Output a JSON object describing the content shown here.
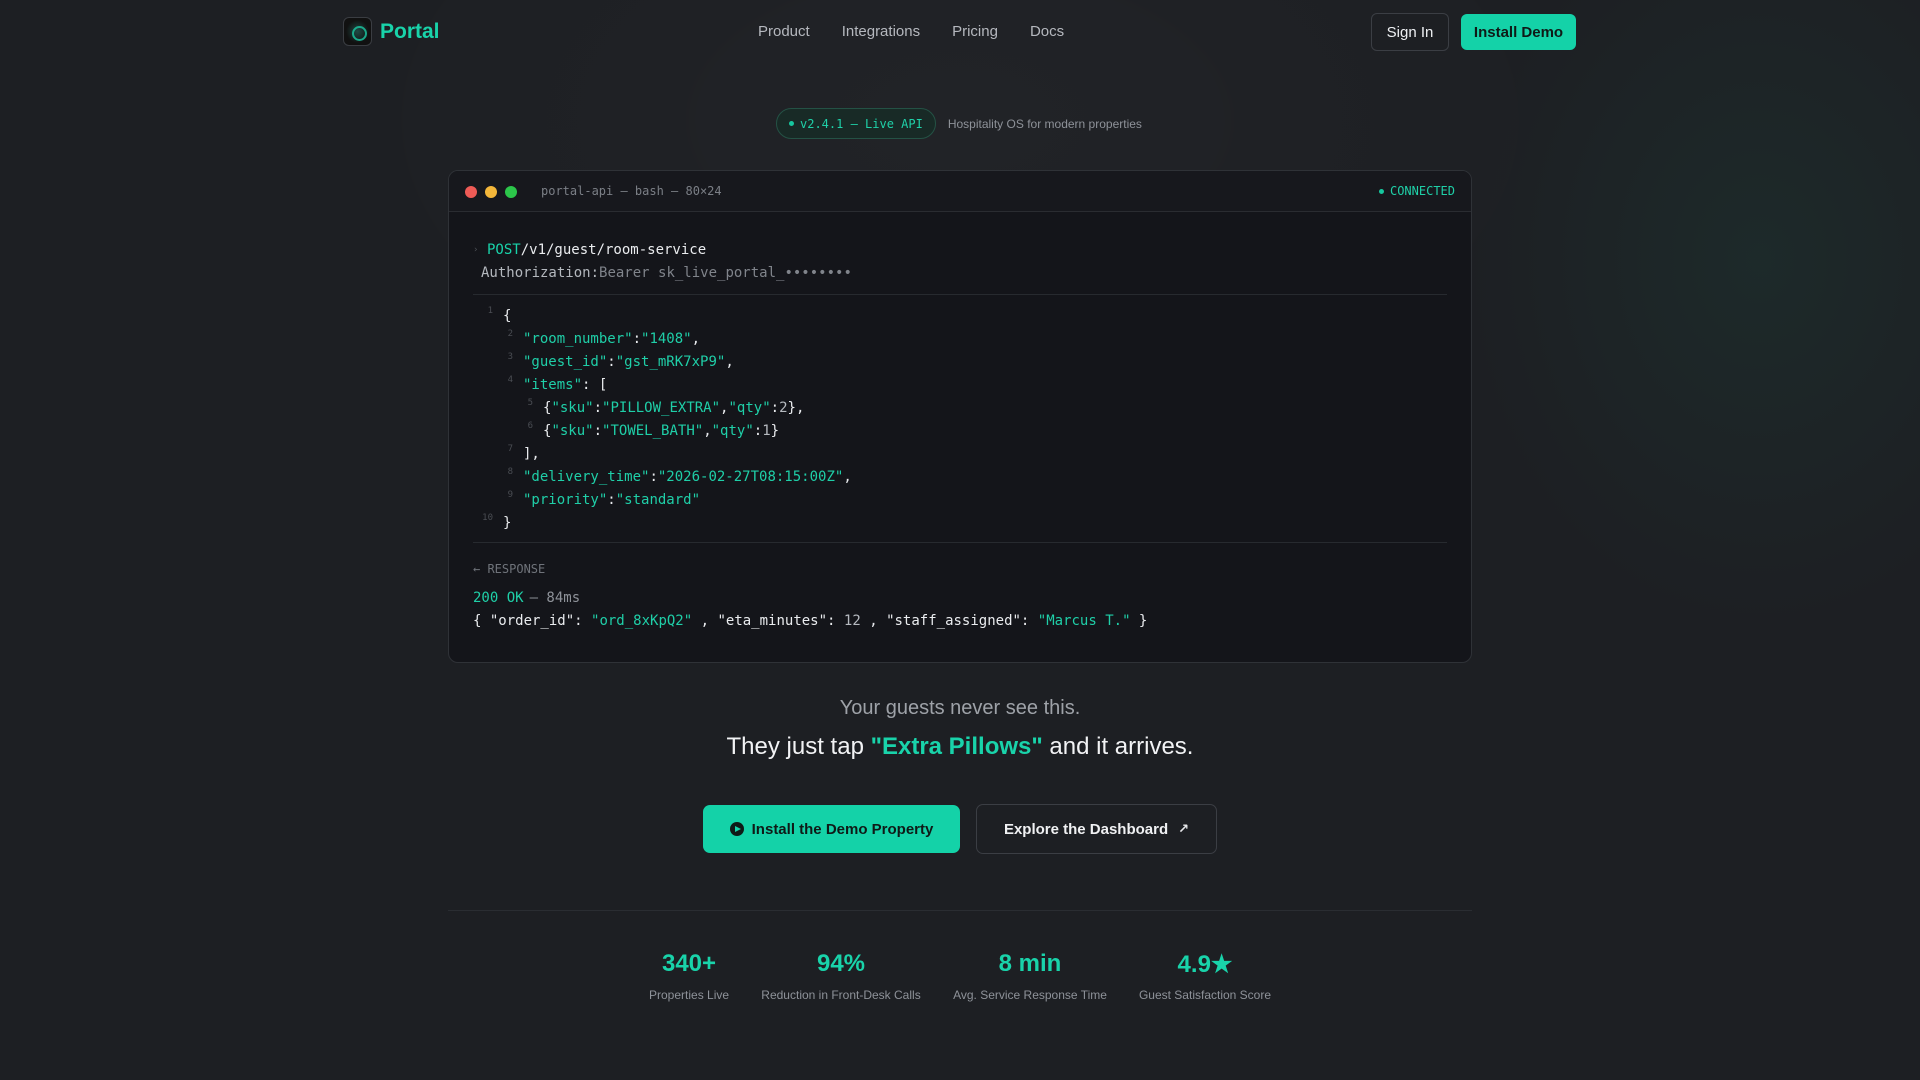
{
  "brand": {
    "name": "Portal",
    "accent": "#14d2a8"
  },
  "nav": {
    "links": [
      "Product",
      "Integrations",
      "Pricing",
      "Docs"
    ],
    "signin_label": "Sign In",
    "install_label": "Install Demo"
  },
  "version": {
    "badge": "v2.4.1 — Live API",
    "tagline": "Hospitality OS for modern properties"
  },
  "terminal": {
    "title": "portal-api — bash — 80×24",
    "status": "CONNECTED",
    "method": "POST",
    "path": "/v1/guest/room-service",
    "auth_key": "Authorization:",
    "auth_value": "Bearer sk_live_portal_••••••••",
    "body": {
      "room_number_key": "\"room_number\"",
      "room_number_val": "\"1408\"",
      "guest_id_key": "\"guest_id\"",
      "guest_id_val": "\"gst_mRK7xP9\"",
      "items_key": "\"items\"",
      "item1_sku_key": "\"sku\"",
      "item1_sku_val": "\"PILLOW_EXTRA\"",
      "item1_qty_key": "\"qty\"",
      "item1_qty_val": "2",
      "item2_sku_key": "\"sku\"",
      "item2_sku_val": "\"TOWEL_BATH\"",
      "item2_qty_key": "\"qty\"",
      "item2_qty_val": "1",
      "delivery_key": "\"delivery_time\"",
      "delivery_val": "\"2026-02-27T08:15:00Z\"",
      "priority_key": "\"priority\"",
      "priority_val": "\"standard\""
    },
    "line_numbers": [
      "1",
      "2",
      "3",
      "4",
      "5",
      "6",
      "7",
      "8",
      "9",
      "10"
    ],
    "response_label": "← RESPONSE",
    "response_status": "200 OK",
    "response_time": "— 84ms",
    "response": {
      "order_id_key": "\"order_id\"",
      "order_id_val": "\"ord_8xKpQ2\"",
      "eta_key": "\"eta_minutes\"",
      "eta_val": "12",
      "staff_key": "\"staff_assigned\"",
      "staff_val": "\"Marcus T.\""
    }
  },
  "hero": {
    "line1": "Your guests never see this.",
    "line2_pre": "They just tap ",
    "line2_highlight": "\"Extra Pillows\"",
    "line2_post": " and it arrives."
  },
  "cta": {
    "primary": "Install the Demo Property",
    "secondary": "Explore the Dashboard",
    "secondary_icon": "↗"
  },
  "stats": [
    {
      "value": "340+",
      "label": "Properties Live"
    },
    {
      "value": "94%",
      "label": "Reduction in Front-Desk Calls"
    },
    {
      "value": "8 min",
      "label": "Avg. Service Response Time"
    },
    {
      "value": "4.9★",
      "label": "Guest Satisfaction Score"
    }
  ]
}
